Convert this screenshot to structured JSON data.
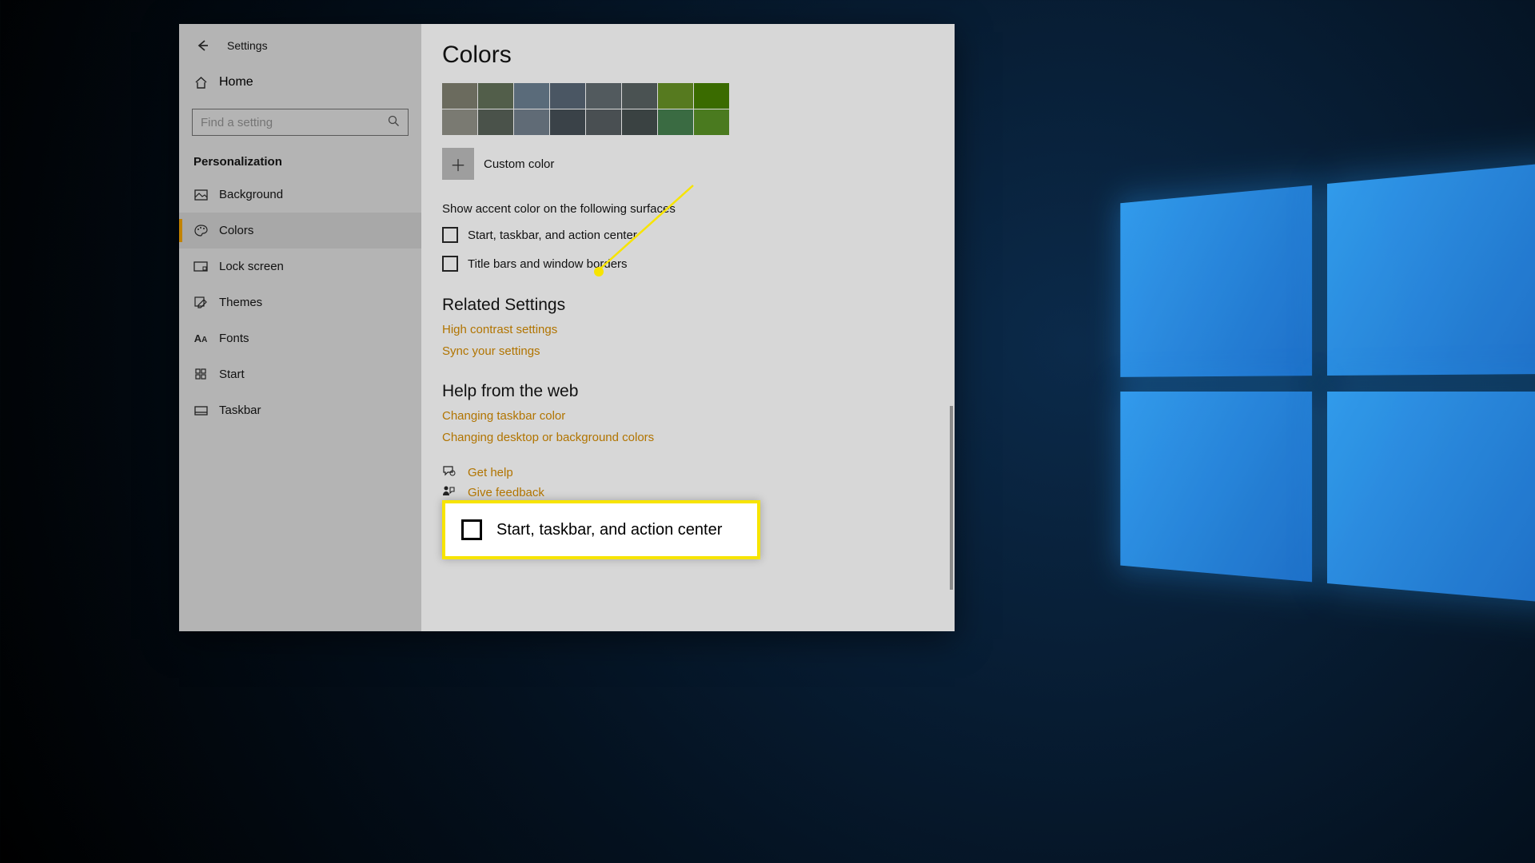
{
  "app_title": "Settings",
  "sidebar": {
    "home": "Home",
    "search_placeholder": "Find a setting",
    "section": "Personalization",
    "items": [
      {
        "label": "Background"
      },
      {
        "label": "Colors"
      },
      {
        "label": "Lock screen"
      },
      {
        "label": "Themes"
      },
      {
        "label": "Fonts"
      },
      {
        "label": "Start"
      },
      {
        "label": "Taskbar"
      }
    ]
  },
  "page": {
    "title": "Colors",
    "swatch_colors": [
      "#6b6b5e",
      "#525e4a",
      "#5a6b7a",
      "#4a5663",
      "#525a5e",
      "#4a5252",
      "#567a1f",
      "#3a6b00",
      "#7a7a72",
      "#4a524a",
      "#606b76",
      "#3a4248",
      "#494f52",
      "#3a4242",
      "#3a6b42",
      "#4a7a1f"
    ],
    "custom_color": "Custom color",
    "surfaces_heading": "Show accent color on the following surfaces",
    "chk1": "Start, taskbar, and action center",
    "chk2": "Title bars and window borders",
    "related_heading": "Related Settings",
    "link_high_contrast": "High contrast settings",
    "link_sync": "Sync your settings",
    "help_heading": "Help from the web",
    "help_link1": "Changing taskbar color",
    "help_link2": "Changing desktop or background colors",
    "get_help": "Get help",
    "give_feedback": "Give feedback"
  },
  "callout": {
    "label": "Start, taskbar, and action center"
  }
}
